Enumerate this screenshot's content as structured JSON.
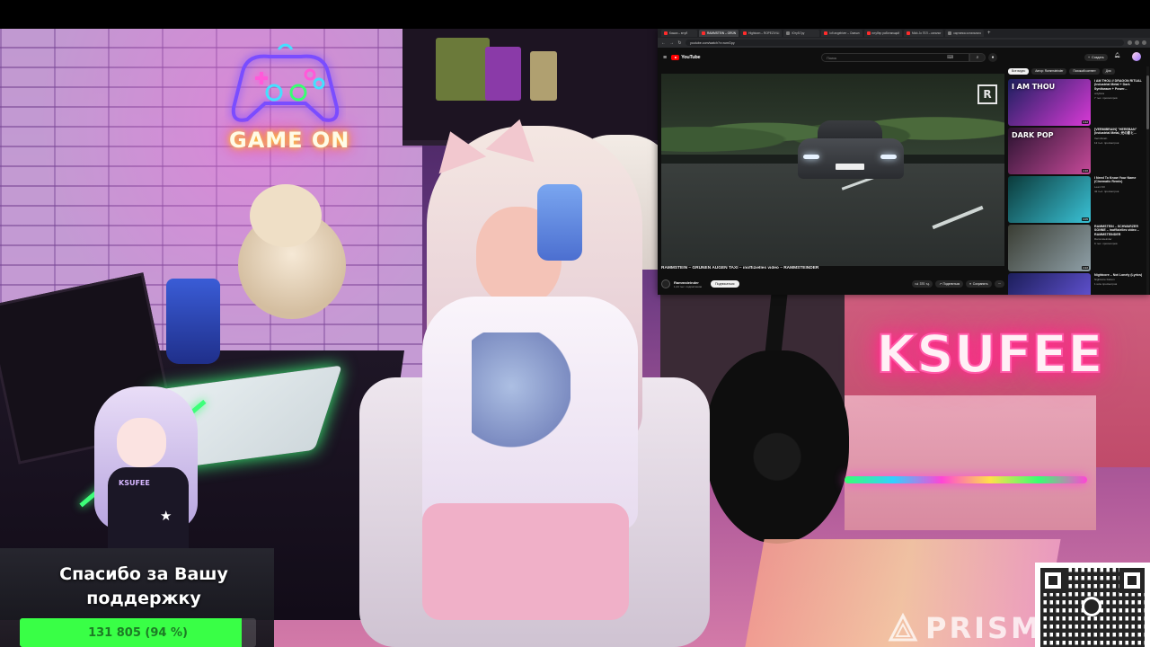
{
  "scene": {
    "neon_sign_left": "GAME ON",
    "neon_sign_right": "KSUFEE",
    "avatar_jacket_text": "KSUFEE"
  },
  "browser": {
    "tabs": [
      {
        "label": "Кошки – ютуб",
        "favicon": "youtube-favicon",
        "active": false
      },
      {
        "label": "RAMMSTEIN – GRÜN",
        "favicon": "youtube-favicon",
        "active": true
      },
      {
        "label": "Hightown – ROPEZIVILI",
        "favicon": "youtube-favicon",
        "active": false
      },
      {
        "label": "Ютуб.Гру",
        "favicon": "page-favicon",
        "active": false
      },
      {
        "label": "lofi angelriver – Смешн",
        "favicon": "youtube-favicon",
        "active": false
      },
      {
        "label": "ютубер работающий",
        "favicon": "youtube-favicon",
        "active": false
      },
      {
        "label": "Mick Jo ГЕЛ – каталог",
        "favicon": "youtube-favicon",
        "active": false
      },
      {
        "label": "картинка остального",
        "favicon": "page-favicon",
        "active": false
      }
    ],
    "new_tab_glyph": "+",
    "url": "youtube.com/watch?v=rumGpy",
    "youtube": {
      "logo_text": "YouTube",
      "search_placeholder": "Поиск",
      "create_label": "Создать",
      "video": {
        "title": "RAMMSTEIN – GRÜNEN AUGEN TAXI – inoffizielles video – RAMMSTEINDER",
        "channel": "Rammsteinder",
        "subscribers": "1,24 тыс. подписчиков",
        "subscribe_label": "Подписаться",
        "like_count": "370",
        "share_label": "Поделиться",
        "save_label": "Сохранить",
        "more_glyph": "⋯"
      },
      "chips": [
        "Все видео",
        "Автор: Rammsteinder",
        "Похожий контент",
        "Для"
      ],
      "recommendations": [
        {
          "thumb_text": "I AM THOU",
          "title": "I AM THOU // DRAGON RITUAL (Industrial Metal + Dark Synthwave + Power...",
          "channel": "onlyfans",
          "views": "7 тыс. просмотров",
          "duration": "3:42",
          "color_a": "#1b1f5e",
          "color_b": "#d93ad6"
        },
        {
          "thumb_text": "DARK POP",
          "title": "[VERMIBRAIN] \"HEREBAN\" (Industrial Metal, 光の影と...",
          "channel": "Vermibrain",
          "views": "12 тыс. просмотров",
          "duration": "4:10",
          "color_a": "#2a1330",
          "color_b": "#c74a9a"
        },
        {
          "thumb_text": "",
          "title": "I Need To Know Your Name (Cinematic Remix)",
          "channel": "Lean NO",
          "views": "42 тыс. просмотров",
          "duration": "3:05",
          "color_a": "#0b3a3a",
          "color_b": "#3ac2d6"
        },
        {
          "thumb_text": "",
          "title": "RAMMSTEIN – SCHWARZER SONNE – inoffizielles video – RAMMSTEINDER",
          "channel": "Rammsteinder",
          "views": "9 тыс. просмотров",
          "duration": "4:22",
          "color_a": "#3a3d33",
          "color_b": "#8fa0a8"
        },
        {
          "thumb_text": "",
          "title": "Nightcore – Not Lonely (Lyrics)",
          "channel": "Nightcore Falcon",
          "views": "1 млн просмотров",
          "duration": "2:58",
          "color_a": "#1c1e5a",
          "color_b": "#6d5be6"
        }
      ]
    }
  },
  "overlay": {
    "donation_title": "Спасибо за Вашу поддержку",
    "donation_amount": "131 805 (94 %)",
    "donation_progress": 0.94,
    "watermark_text": "PRISM"
  },
  "colors": {
    "progress_fill": "#39ff46",
    "neon_pink": "#ff2d8a",
    "youtube_red": "#ff0000"
  }
}
